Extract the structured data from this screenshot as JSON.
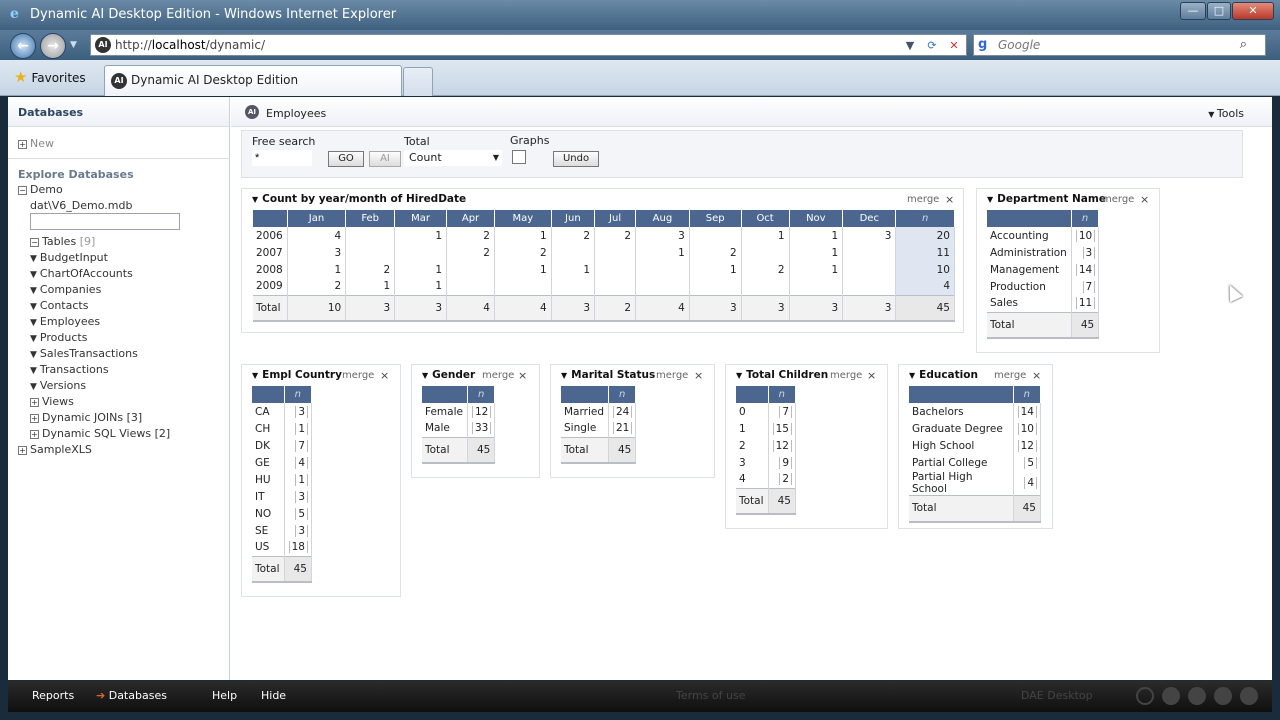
{
  "window": {
    "title": "Dynamic AI Desktop Edition - Windows Internet Explorer",
    "min": "—",
    "max": "□",
    "close": "✕"
  },
  "address": {
    "url_prefix": "http://",
    "url_host": "localhost",
    "url_path": "/dynamic/",
    "search_placeholder": "Google"
  },
  "tabs": {
    "favorites": "Favorites",
    "active_tab": "Dynamic AI Desktop Edition"
  },
  "sidebar": {
    "header": "Databases",
    "new_label": "New",
    "explore_label": "Explore Databases",
    "demo": "Demo",
    "db_path": "dat\\V6_Demo.mdb",
    "tables_label": "Tables",
    "tables_count": "[9]",
    "tables": [
      "BudgetInput",
      "ChartOfAccounts",
      "Companies",
      "Contacts",
      "Employees",
      "Products",
      "SalesTransactions",
      "Transactions",
      "Versions"
    ],
    "views": "Views",
    "joins": "Dynamic JOINs [3]",
    "sqlviews": "Dynamic SQL Views [2]",
    "samplexls": "SampleXLS"
  },
  "main": {
    "title": "Employees",
    "tools": "Tools",
    "search": {
      "free_label": "Free search",
      "free_value": "*",
      "go": "GO",
      "ai": "AI",
      "total_label": "Total",
      "total_value": "Count",
      "graphs_label": "Graphs",
      "undo": "Undo"
    },
    "merge": "merge",
    "close": "×",
    "total_label": "Total",
    "n_label": "n"
  },
  "crosstab": {
    "title": "Count by year/month of HiredDate",
    "months": [
      "Jan",
      "Feb",
      "Mar",
      "Apr",
      "May",
      "Jun",
      "Jul",
      "Aug",
      "Sep",
      "Oct",
      "Nov",
      "Dec"
    ],
    "rows": [
      {
        "year": "2006",
        "cells": [
          "4",
          "",
          "1",
          "2",
          "1",
          "2",
          "2",
          "3",
          "",
          "1",
          "1",
          "3"
        ],
        "n": "20"
      },
      {
        "year": "2007",
        "cells": [
          "3",
          "",
          "",
          "2",
          "2",
          "",
          "",
          "1",
          "2",
          "",
          "1",
          ""
        ],
        "n": "11"
      },
      {
        "year": "2008",
        "cells": [
          "1",
          "2",
          "1",
          "",
          "1",
          "1",
          "",
          "",
          "1",
          "2",
          "1",
          ""
        ],
        "n": "10"
      },
      {
        "year": "2009",
        "cells": [
          "2",
          "1",
          "1",
          "",
          "",
          "",
          "",
          "",
          "",
          "",
          "",
          ""
        ],
        "n": "4"
      }
    ],
    "totals": [
      "10",
      "3",
      "3",
      "4",
      "4",
      "3",
      "2",
      "4",
      "3",
      "3",
      "3",
      "3"
    ],
    "grand": "45"
  },
  "department": {
    "title": "Department Name",
    "rows": [
      [
        "Accounting",
        "10"
      ],
      [
        "Administration",
        "3"
      ],
      [
        "Management",
        "14"
      ],
      [
        "Production",
        "7"
      ],
      [
        "Sales",
        "11"
      ]
    ],
    "total": "45"
  },
  "country": {
    "title": "Empl Country",
    "rows": [
      [
        "CA",
        "3"
      ],
      [
        "CH",
        "1"
      ],
      [
        "DK",
        "7"
      ],
      [
        "GE",
        "4"
      ],
      [
        "HU",
        "1"
      ],
      [
        "IT",
        "3"
      ],
      [
        "NO",
        "5"
      ],
      [
        "SE",
        "3"
      ],
      [
        "US",
        "18"
      ]
    ],
    "total": "45"
  },
  "gender": {
    "title": "Gender",
    "rows": [
      [
        "Female",
        "12"
      ],
      [
        "Male",
        "33"
      ]
    ],
    "total": "45"
  },
  "marital": {
    "title": "Marital Status",
    "rows": [
      [
        "Married",
        "24"
      ],
      [
        "Single",
        "21"
      ]
    ],
    "total": "45"
  },
  "children": {
    "title": "Total Children",
    "rows": [
      [
        "0",
        "7"
      ],
      [
        "1",
        "15"
      ],
      [
        "2",
        "12"
      ],
      [
        "3",
        "9"
      ],
      [
        "4",
        "2"
      ]
    ],
    "total": "45"
  },
  "education": {
    "title": "Education",
    "rows": [
      [
        "Bachelors",
        "14"
      ],
      [
        "Graduate Degree",
        "10"
      ],
      [
        "High School",
        "12"
      ],
      [
        "Partial College",
        "5"
      ],
      [
        "Partial High School",
        "4"
      ]
    ],
    "total": "45"
  },
  "bottom": {
    "reports": "Reports",
    "databases": "Databases",
    "help": "Help",
    "hide": "Hide",
    "terms": "Terms of use",
    "dae": "DAE Desktop"
  }
}
